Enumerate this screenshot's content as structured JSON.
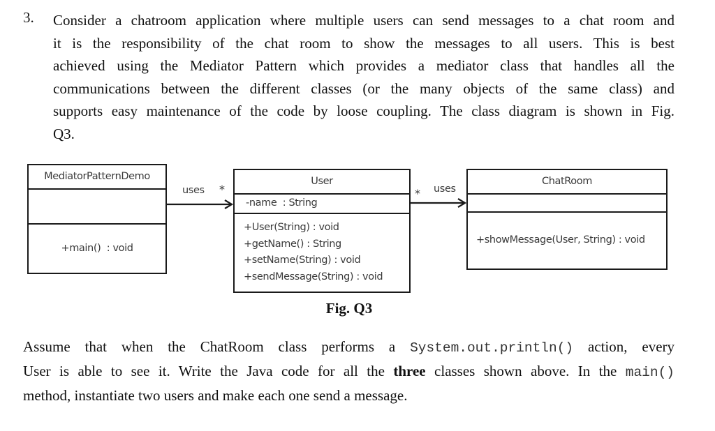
{
  "question": {
    "number": "3.",
    "intro_lines": [
      "Consider a chatroom application where multiple users can send messages to a chat room and",
      "it is the responsibility of the chat room to show the messages to all users. This is best",
      "achieved using the Mediator Pattern which provides a mediator class that handles all the",
      "communications between the different classes (or the many objects of the same class) and",
      "supports easy maintenance of the code by loose coupling. The class diagram is shown in Fig.",
      "Q3."
    ]
  },
  "diagram": {
    "classes": [
      {
        "name": "MediatorPatternDemo",
        "attributes": [],
        "methods": [
          "+main()  : void"
        ]
      },
      {
        "name": "User",
        "attributes": [
          "-name  : String"
        ],
        "methods": [
          "+User(String) : void",
          "+getName() : String",
          "+setName(String) : void",
          "+sendMessage(String) : void"
        ]
      },
      {
        "name": "ChatRoom",
        "attributes": [],
        "methods": [
          "+showMessage(User, String) : void"
        ]
      }
    ],
    "associations": [
      {
        "from": "MediatorPatternDemo",
        "to": "User",
        "label": "uses",
        "multiplicity": "*"
      },
      {
        "from": "User",
        "to": "ChatRoom",
        "label": "uses",
        "multiplicity": "*"
      }
    ],
    "caption": "Fig. Q3"
  },
  "instructions": {
    "line1_a": "Assume that when the ChatRoom class performs a ",
    "line1_code": "System.out.println()",
    "line1_b": " action, every",
    "line2_a": "User is able to see it. Write the Java code for all the ",
    "line2_bold": "three",
    "line2_b": " classes shown above. In the ",
    "line2_code": "main()",
    "line3": "method, instantiate two users and make each one send a message."
  }
}
